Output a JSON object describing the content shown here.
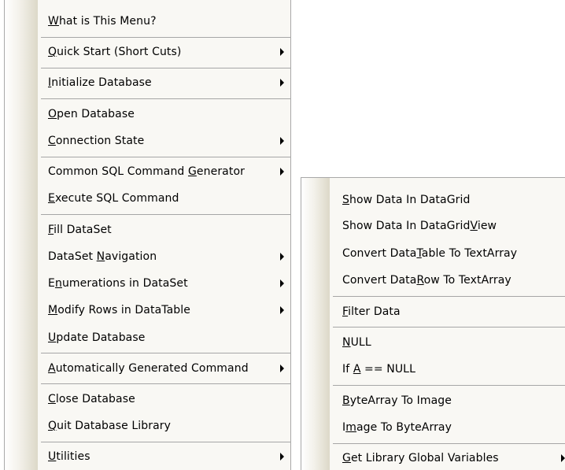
{
  "main_menu": {
    "items": [
      {
        "label": "What is This Menu?",
        "mnemonic": 0,
        "submenu": false
      },
      {
        "label": "Quick Start (Short Cuts)",
        "mnemonic": 0,
        "submenu": true
      },
      {
        "label": "Initialize Database",
        "mnemonic": 0,
        "submenu": true
      },
      {
        "label": "Open Database",
        "mnemonic": 0,
        "submenu": false
      },
      {
        "label": "Connection State",
        "mnemonic": 0,
        "submenu": true
      },
      {
        "label": "Common SQL Command Generator",
        "mnemonic": 19,
        "submenu": true
      },
      {
        "label": "Execute SQL Command",
        "mnemonic": 0,
        "submenu": false
      },
      {
        "label": "Fill DataSet",
        "mnemonic": 0,
        "submenu": false
      },
      {
        "label": "DataSet Navigation",
        "mnemonic": 8,
        "submenu": true
      },
      {
        "label": "Enumerations in DataSet",
        "mnemonic": 1,
        "submenu": true
      },
      {
        "label": "Modify Rows in DataTable",
        "mnemonic": 0,
        "submenu": true
      },
      {
        "label": "Update Database",
        "mnemonic": 0,
        "submenu": false
      },
      {
        "label": "Automatically Generated Command",
        "mnemonic": 0,
        "submenu": true
      },
      {
        "label": "Close Database",
        "mnemonic": 0,
        "submenu": false
      },
      {
        "label": "Quit Database Library",
        "mnemonic": 0,
        "submenu": false
      },
      {
        "label": "Utilities",
        "mnemonic": 0,
        "submenu": true
      }
    ]
  },
  "sub_menu": {
    "items": [
      {
        "label": "Show Data In DataGrid",
        "mnemonic": 0,
        "submenu": false
      },
      {
        "label": "Show Data In DataGridView",
        "mnemonic": 21,
        "submenu": false
      },
      {
        "label": "Convert DataTable To TextArray",
        "mnemonic": 12,
        "submenu": false
      },
      {
        "label": "Convert DataRow To TextArray",
        "mnemonic": 12,
        "submenu": false
      },
      {
        "label": "Filter Data",
        "mnemonic": 0,
        "submenu": false
      },
      {
        "label": "NULL",
        "mnemonic": 0,
        "submenu": false
      },
      {
        "label": "If A == NULL",
        "mnemonic": 3,
        "submenu": false
      },
      {
        "label": "ByteArray To Image",
        "mnemonic": 0,
        "submenu": false
      },
      {
        "label": "Image To ByteArray",
        "mnemonic": 1,
        "submenu": false
      },
      {
        "label": "Get Library Global Variables",
        "mnemonic": 0,
        "submenu": true
      }
    ]
  },
  "icons": {
    "submenu_arrow": "triangle-right-icon"
  },
  "colors": {
    "menu_bg": "#f9f8f4",
    "separator": "#a6a6a6",
    "border": "#a8a8a8"
  }
}
